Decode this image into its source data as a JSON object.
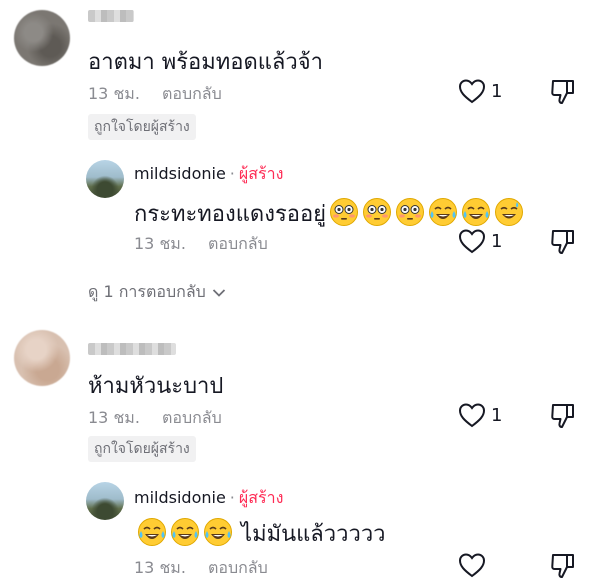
{
  "comments": [
    {
      "text": "อาตมา พร้อมทอดแล้วจ้า",
      "time": "13 ชม.",
      "reply_label": "ตอบกลับ",
      "likes": "1",
      "liked_badge": "ถูกใจโดยผู้สร้าง",
      "reply": {
        "username": "mildsidonie",
        "dot": "·",
        "creator_tag": "ผู้สร้าง",
        "text": "กระทะทองแดงรออยู่",
        "emojis": [
          "flushed-face-emoji",
          "flushed-face-emoji",
          "flushed-face-emoji",
          "tears-of-joy-emoji",
          "tears-of-joy-emoji",
          "grinning-sweat-emoji"
        ],
        "time": "13 ชม.",
        "reply_label": "ตอบกลับ",
        "likes": "1"
      },
      "view_replies": "ดู 1 การตอบกลับ"
    },
    {
      "text": "ห้ามหัวนะบาป",
      "time": "13 ชม.",
      "reply_label": "ตอบกลับ",
      "likes": "1",
      "liked_badge": "ถูกใจโดยผู้สร้าง",
      "reply": {
        "username": "mildsidonie",
        "dot": "·",
        "creator_tag": "ผู้สร้าง",
        "text": "ไม่มันแล้ววววว",
        "emojis": [
          "tears-of-joy-emoji",
          "tears-of-joy-emoji",
          "tears-of-joy-emoji"
        ],
        "time": "13 ชม.",
        "reply_label": "ตอบกลับ",
        "likes": ""
      }
    }
  ],
  "icons": {
    "like": "heart-outline-icon",
    "dislike": "thumbs-down-icon",
    "expand": "chevron-down-icon"
  },
  "colors": {
    "creator_accent": "#fe2c55",
    "meta_gray": "#8a8b91",
    "badge_bg": "#f1f1f2"
  }
}
